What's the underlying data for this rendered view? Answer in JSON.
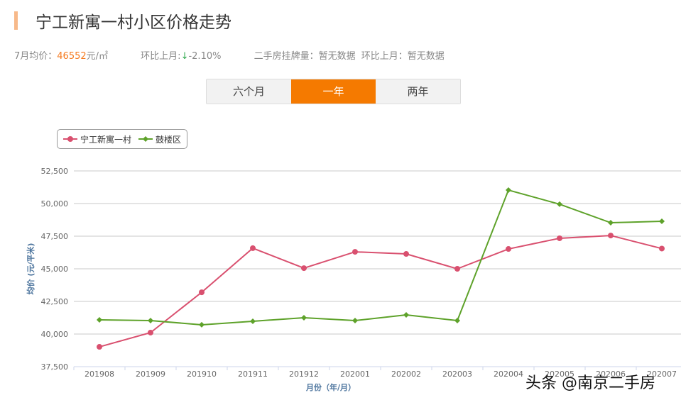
{
  "header": {
    "title": "宁工新寓一村小区价格走势"
  },
  "stats": {
    "avg_label": "7月均价：",
    "avg_value": "46552",
    "avg_unit": "元/㎡",
    "mom_label": "环比上月:",
    "mom_arrow": "↓",
    "mom_value": "-2.10%",
    "listing_label": "二手房挂牌量：",
    "listing_value": "暂无数据",
    "listing_mom_label": "环比上月：",
    "listing_mom_value": "暂无数据"
  },
  "tabs": [
    {
      "label": "六个月",
      "active": false
    },
    {
      "label": "一年",
      "active": true
    },
    {
      "label": "两年",
      "active": false
    }
  ],
  "watermark": "头条 @南京二手房",
  "chart_data": {
    "type": "line",
    "xlabel": "月份（年/月）",
    "ylabel": "均价 (元/平米)",
    "ylim": [
      37500,
      52500
    ],
    "yticks": [
      "37,500",
      "40,000",
      "42,500",
      "45,000",
      "47,500",
      "50,000",
      "52,500"
    ],
    "grid": true,
    "legend": "top-left",
    "categories": [
      "201908",
      "201909",
      "201910",
      "201911",
      "201912",
      "202001",
      "202002",
      "202003",
      "202004",
      "202005",
      "202006",
      "202007"
    ],
    "series": [
      {
        "name": "宁工新寓一村",
        "color": "#d9506f",
        "marker": "circle",
        "values": [
          39020,
          40110,
          43200,
          46580,
          45050,
          46300,
          46140,
          45000,
          46520,
          47340,
          47550,
          46552
        ]
      },
      {
        "name": "鼓楼区",
        "color": "#5ea22a",
        "marker": "diamond",
        "values": [
          41090,
          41030,
          40710,
          40980,
          41250,
          41030,
          41470,
          41030,
          51030,
          49950,
          48530,
          48640
        ]
      }
    ]
  }
}
